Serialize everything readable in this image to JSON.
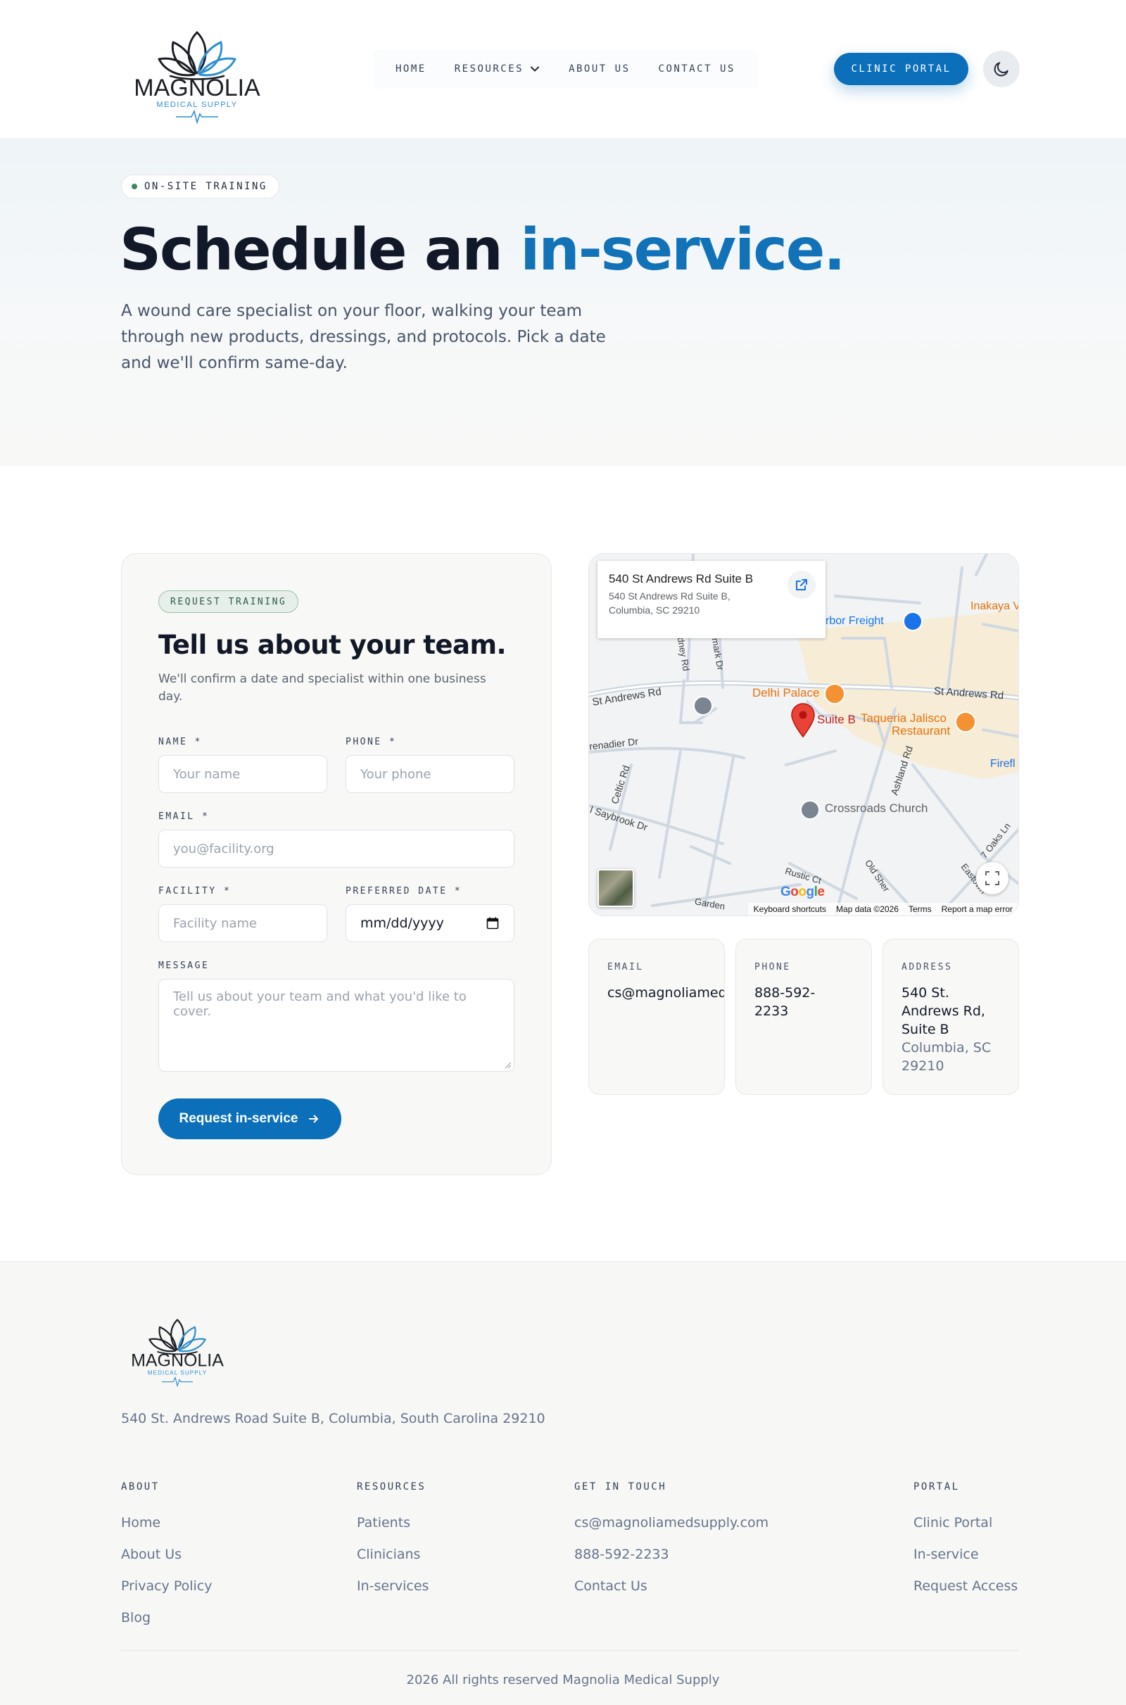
{
  "brand": {
    "name": "MAGNOLIA",
    "tagline": "MEDICAL SUPPLY"
  },
  "nav": {
    "items": [
      {
        "label": "HOME"
      },
      {
        "label": "RESOURCES",
        "has_dropdown": true
      },
      {
        "label": "ABOUT US"
      },
      {
        "label": "CONTACT US"
      }
    ],
    "portal_button": "CLINIC PORTAL",
    "theme_toggle_icon": "moon-icon"
  },
  "hero": {
    "pill": "ON-SITE TRAINING",
    "title_main": "Schedule an ",
    "title_accent": "in-service.",
    "description": "A wound care specialist on your floor, walking your team through new products, dressings, and protocols. Pick a date and we'll confirm same-day."
  },
  "form": {
    "badge": "REQUEST TRAINING",
    "title": "Tell us about your team.",
    "subtitle": "We'll confirm a date and specialist within one business day.",
    "fields": {
      "name": {
        "label": "NAME *",
        "placeholder": "Your name",
        "value": ""
      },
      "phone": {
        "label": "PHONE *",
        "placeholder": "Your phone",
        "value": ""
      },
      "email": {
        "label": "EMAIL *",
        "placeholder": "you@facility.org",
        "value": ""
      },
      "facility": {
        "label": "FACILITY *",
        "placeholder": "Facility name",
        "value": ""
      },
      "date": {
        "label": "PREFERRED DATE *",
        "value": "mm/dd/yyyy"
      },
      "message": {
        "label": "MESSAGE",
        "placeholder": "Tell us about your team and what you'd like to cover.",
        "value": ""
      }
    },
    "submit": "Request in-service"
  },
  "map": {
    "card_title": "540 St Andrews Rd Suite B",
    "card_address": "540 St Andrews Rd Suite B, Columbia, SC 29210",
    "pin_label": "Suite B",
    "places": {
      "delhi": "Delhi Palace",
      "taqueria_1": "Taqueria Jalisco",
      "taqueria_2": "Restaurant",
      "church": "Crossroads Church",
      "harbor": "rbor Freight",
      "inakaya": "Inakaya V",
      "firefly": "Firefl"
    },
    "roads": {
      "st_andrews_left": "St Andrews Rd",
      "st_andrews_right": "St Andrews Rd",
      "grenadier": "renadier Dr",
      "celtic": "Celtic Rd",
      "saybrook": "l Saybrook Dr",
      "ashland": "Ashland Rd",
      "rustic": "Rustic Ct",
      "old_sher": "Old Sher",
      "oaks": "7 Oaks Ln",
      "eastown": "Eastown",
      "garden": "Garden",
      "dney": "dney Rd",
      "mark": "mark Dr"
    },
    "footer": {
      "shortcuts": "Keyboard shortcuts",
      "data": "Map data ©2026",
      "terms": "Terms",
      "report": "Report a map error"
    },
    "google": "Google"
  },
  "contact_cards": {
    "email": {
      "label": "EMAIL",
      "value": "cs@magnoliamedsupply.com"
    },
    "phone": {
      "label": "PHONE",
      "value": "888-592-2233"
    },
    "address": {
      "label": "ADDRESS",
      "line1": "540 St. Andrews Rd, Suite B",
      "line2": "Columbia, SC 29210"
    }
  },
  "footer": {
    "address": "540 St. Andrews Road Suite B, Columbia, South Carolina 29210",
    "columns": [
      {
        "heading": "ABOUT",
        "links": [
          "Home",
          "About Us",
          "Privacy Policy",
          "Blog"
        ]
      },
      {
        "heading": "RESOURCES",
        "links": [
          "Patients",
          "Clinicians",
          "In-services"
        ]
      },
      {
        "heading": "GET IN TOUCH",
        "links": [
          "cs@magnoliamedsupply.com",
          "888-592-2233",
          "Contact Us"
        ]
      },
      {
        "heading": "PORTAL",
        "links": [
          "Clinic Portal",
          "In-service",
          "Request Access"
        ]
      }
    ],
    "copyright": "2026 All rights reserved Magnolia Medical Supply"
  },
  "colors": {
    "accent": "#0b6fba",
    "heading": "#111827",
    "muted": "#64748b"
  }
}
